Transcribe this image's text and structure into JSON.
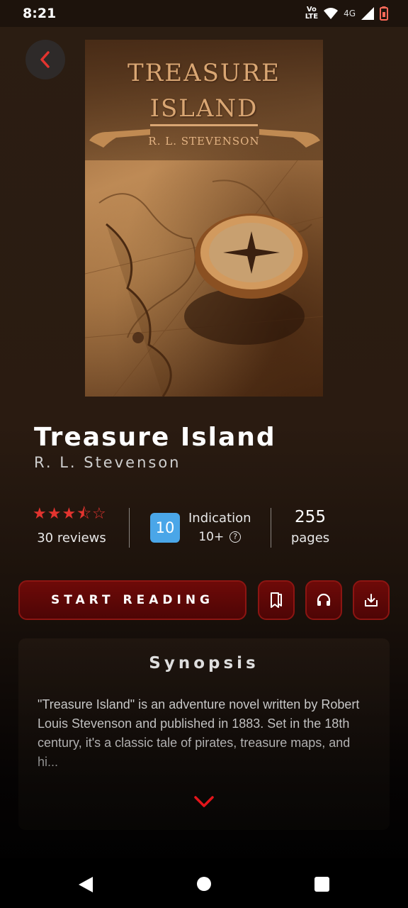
{
  "status_bar": {
    "time": "8:21",
    "volte_top": "Vo",
    "volte_bottom": "LTE",
    "network": "4G"
  },
  "book": {
    "cover_title_line1": "Treasure",
    "cover_title_line2": "Island",
    "cover_author": "R. L. Stevenson",
    "title": "Treasure Island",
    "author": "R. L. Stevenson"
  },
  "stats": {
    "rating": 3.5,
    "rating_max": 5,
    "stars": [
      "★",
      "★",
      "★",
      "⯪",
      "☆"
    ],
    "reviews": "30 reviews",
    "age_badge": "10",
    "indication_label": "Indication",
    "indication_age": "10+",
    "help_glyph": "?",
    "pages_count": "255",
    "pages_label": "pages"
  },
  "actions": {
    "start_label": "START READING",
    "bookmark_icon": "bookmark-icon",
    "audio_icon": "headphones-icon",
    "download_icon": "download-icon"
  },
  "synopsis": {
    "title": "Synopsis",
    "text": "\"Treasure Island\" is an adventure novel written by Robert Louis Stevenson and published in 1883. Set in the 18th century, it's a classic tale of pirates, treasure maps, and hi..."
  },
  "colors": {
    "accent": "#e3342f",
    "button": "#5e0807",
    "badge": "#4aa6e8"
  }
}
